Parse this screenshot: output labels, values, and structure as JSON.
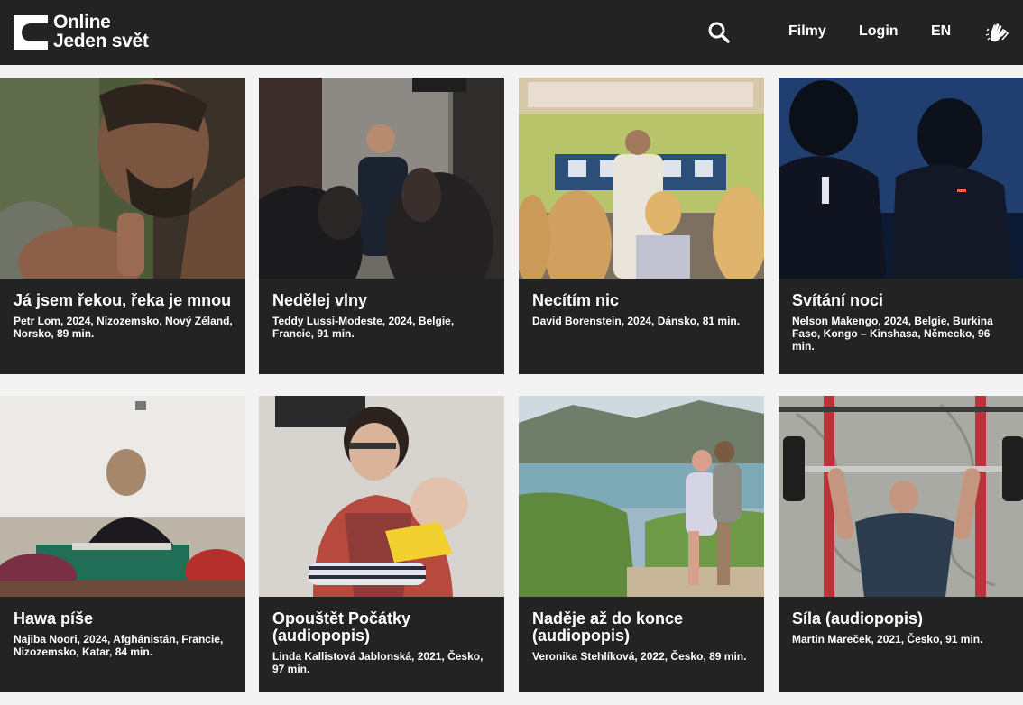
{
  "header": {
    "logo_line1": "Online",
    "logo_line2": "Jeden svět",
    "nav": {
      "films": "Filmy",
      "login": "Login",
      "lang": "EN"
    },
    "icons": {
      "search": "search-icon",
      "sign_language": "sign-language-icon"
    }
  },
  "films": [
    {
      "title": "Já jsem řekou, řeka je mnou",
      "meta": "Petr Lom, 2024, Nizozemsko, Nový Zéland, Norsko, 89 min."
    },
    {
      "title": "Nedělej vlny",
      "meta": "Teddy Lussi-Modeste, 2024, Belgie, Francie, 91 min."
    },
    {
      "title": "Necítím nic",
      "meta": "David Borenstein, 2024, Dánsko, 81 min."
    },
    {
      "title": "Svítání noci",
      "meta": "Nelson Makengo, 2024, Belgie, Burkina Faso, Kongo – Kinshasa, Německo, 96 min."
    },
    {
      "title": "Hawa píše",
      "meta": "Najiba Noori, 2024, Afghánistán, Francie, Nizozemsko, Katar, 84 min."
    },
    {
      "title": "Opouštět Počátky (audiopopis)",
      "meta": "Linda Kallistová Jablonská, 2021, Česko, 97 min."
    },
    {
      "title": "Naděje až do konce (audiopopis)",
      "meta": "Veronika Stehlíková, 2022, Česko, 89 min."
    },
    {
      "title": "Síla (audiopopis)",
      "meta": "Martin Mareček, 2021, Česko, 91 min."
    }
  ]
}
